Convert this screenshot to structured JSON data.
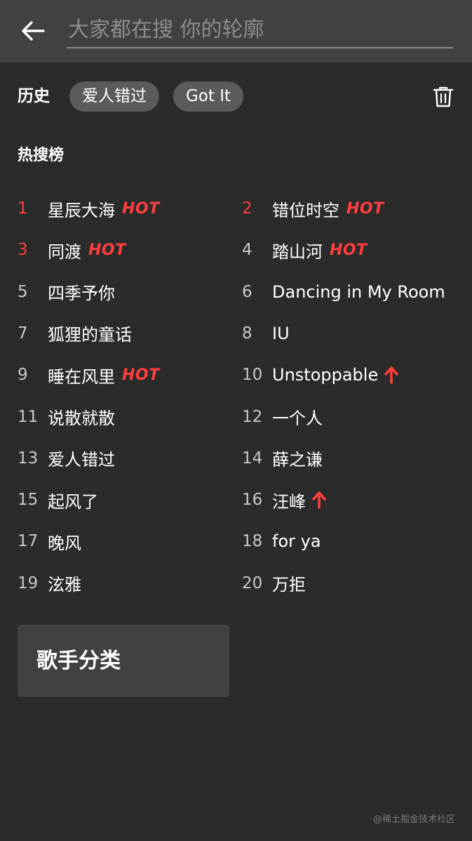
{
  "search": {
    "placeholder": "大家都在搜 你的轮廓",
    "value": ""
  },
  "history": {
    "title": "历史",
    "chips": [
      "爱人错过",
      "Got It"
    ]
  },
  "hot_list": {
    "title": "热搜榜",
    "items": [
      {
        "rank": "1",
        "title": "星辰大海",
        "tag": "HOT",
        "highlight": true
      },
      {
        "rank": "2",
        "title": "错位时空",
        "tag": "HOT",
        "highlight": true
      },
      {
        "rank": "3",
        "title": "同渡",
        "tag": "HOT",
        "highlight": true
      },
      {
        "rank": "4",
        "title": "踏山河",
        "tag": "HOT",
        "highlight": false
      },
      {
        "rank": "5",
        "title": "四季予你",
        "tag": "",
        "highlight": false
      },
      {
        "rank": "6",
        "title": "Dancing in My Room",
        "tag": "",
        "highlight": false
      },
      {
        "rank": "7",
        "title": "狐狸的童话",
        "tag": "",
        "highlight": false
      },
      {
        "rank": "8",
        "title": "IU",
        "tag": "",
        "highlight": false
      },
      {
        "rank": "9",
        "title": "睡在风里",
        "tag": "HOT",
        "highlight": false
      },
      {
        "rank": "10",
        "title": "Unstoppable",
        "tag": "up",
        "highlight": false
      },
      {
        "rank": "11",
        "title": "说散就散",
        "tag": "",
        "highlight": false
      },
      {
        "rank": "12",
        "title": "一个人",
        "tag": "",
        "highlight": false
      },
      {
        "rank": "13",
        "title": "爱人错过",
        "tag": "",
        "highlight": false
      },
      {
        "rank": "14",
        "title": "薛之谦",
        "tag": "",
        "highlight": false
      },
      {
        "rank": "15",
        "title": "起风了",
        "tag": "",
        "highlight": false
      },
      {
        "rank": "16",
        "title": "汪峰",
        "tag": "up",
        "highlight": false
      },
      {
        "rank": "17",
        "title": "晚风",
        "tag": "",
        "highlight": false
      },
      {
        "rank": "18",
        "title": "for ya",
        "tag": "",
        "highlight": false
      },
      {
        "rank": "19",
        "title": "泫雅",
        "tag": "",
        "highlight": false
      },
      {
        "rank": "20",
        "title": "万拒",
        "tag": "",
        "highlight": false
      }
    ]
  },
  "singer_category": {
    "label": "歌手分类"
  },
  "watermark": "@稀土掘金技术社区",
  "colors": {
    "accent": "#ff3e3e",
    "background": "#2b2b2b",
    "header": "#414141",
    "chip": "#5b5b5b"
  },
  "icons": {
    "back": "arrow-left-icon",
    "delete": "trash-icon",
    "rising": "arrow-up-icon"
  }
}
